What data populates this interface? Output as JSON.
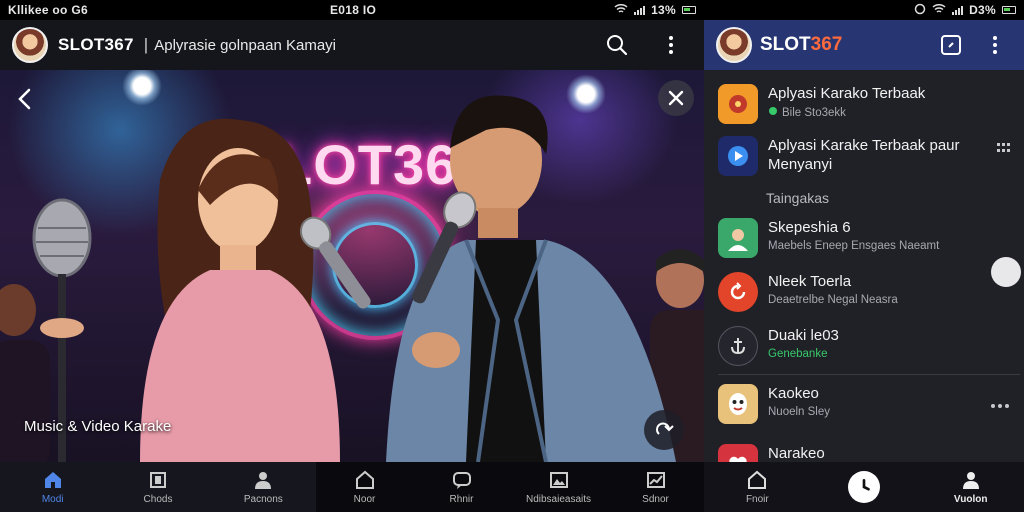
{
  "left": {
    "status": {
      "left_text": "Kllikee oo G6",
      "mid_text": "E018 IO",
      "right_text": "13%"
    },
    "appbar": {
      "brand": "SLOT367",
      "separator": "|",
      "subtitle": "Aplyrasie golnpaan Kamayi"
    },
    "scene": {
      "neon_text": "LOT36",
      "caption": "Music & Video  Karake"
    },
    "bottom_nav": [
      {
        "label": "Modi",
        "icon": "home-icon",
        "active": true
      },
      {
        "label": "Chods",
        "icon": "square-icon",
        "active": false
      },
      {
        "label": "Pacnons",
        "icon": "person-icon",
        "active": false
      },
      {
        "label": "Noor",
        "icon": "home-outline-icon",
        "active": false
      },
      {
        "label": "Rhnir",
        "icon": "chat-icon",
        "active": false
      },
      {
        "label": "Ndibsaieasaits",
        "icon": "gallery-icon",
        "active": false
      },
      {
        "label": "Sdnor",
        "icon": "chart-icon",
        "active": false
      }
    ]
  },
  "right": {
    "status": {
      "right_text": "D3%"
    },
    "appbar": {
      "brand_main": "SLOT",
      "brand_accent": "367"
    },
    "items": [
      {
        "title": "Aplyasi Karako Terbaak",
        "sub": "Bile  Sto3ekk",
        "sub_green": false,
        "icon": "music-app-icon",
        "color": "#f19a2a"
      },
      {
        "title": "Aplyasi Karake Terbaak paur Menyanyi",
        "sub": "",
        "sub_green": false,
        "icon": "play-app-icon",
        "color": "#1f2a6a"
      }
    ],
    "section_header": "Taingakas",
    "items2": [
      {
        "title": "Skepeshia 6",
        "sub": "Maebels Eneep Ensgaes Naeamt",
        "sub_green": false,
        "icon": "avatar-app-icon",
        "color": "#3aa86a"
      },
      {
        "title": "Nleek Toerla",
        "sub": "Deaetrelbe Negal Neasra",
        "sub_green": false,
        "icon": "refresh-app-icon",
        "color": "#e2452a"
      },
      {
        "title": "Duaki le03",
        "sub": "Genebanke",
        "sub_green": true,
        "icon": "anchor-app-icon",
        "color": "#25252e"
      },
      {
        "title": "Kaokeo",
        "sub": "Nuoeln Sley",
        "sub_green": false,
        "icon": "mask-app-icon",
        "color": "#e8c27a"
      },
      {
        "title": "Narakeo",
        "sub": "",
        "sub_green": false,
        "icon": "heart-app-icon",
        "color": "#d5333d"
      }
    ],
    "bottom_nav": [
      {
        "label": "Fnoir",
        "icon": "home-outline-icon"
      },
      {
        "label": "",
        "icon": "clock-icon"
      },
      {
        "label": "Vuolon",
        "icon": "person-icon"
      }
    ]
  }
}
